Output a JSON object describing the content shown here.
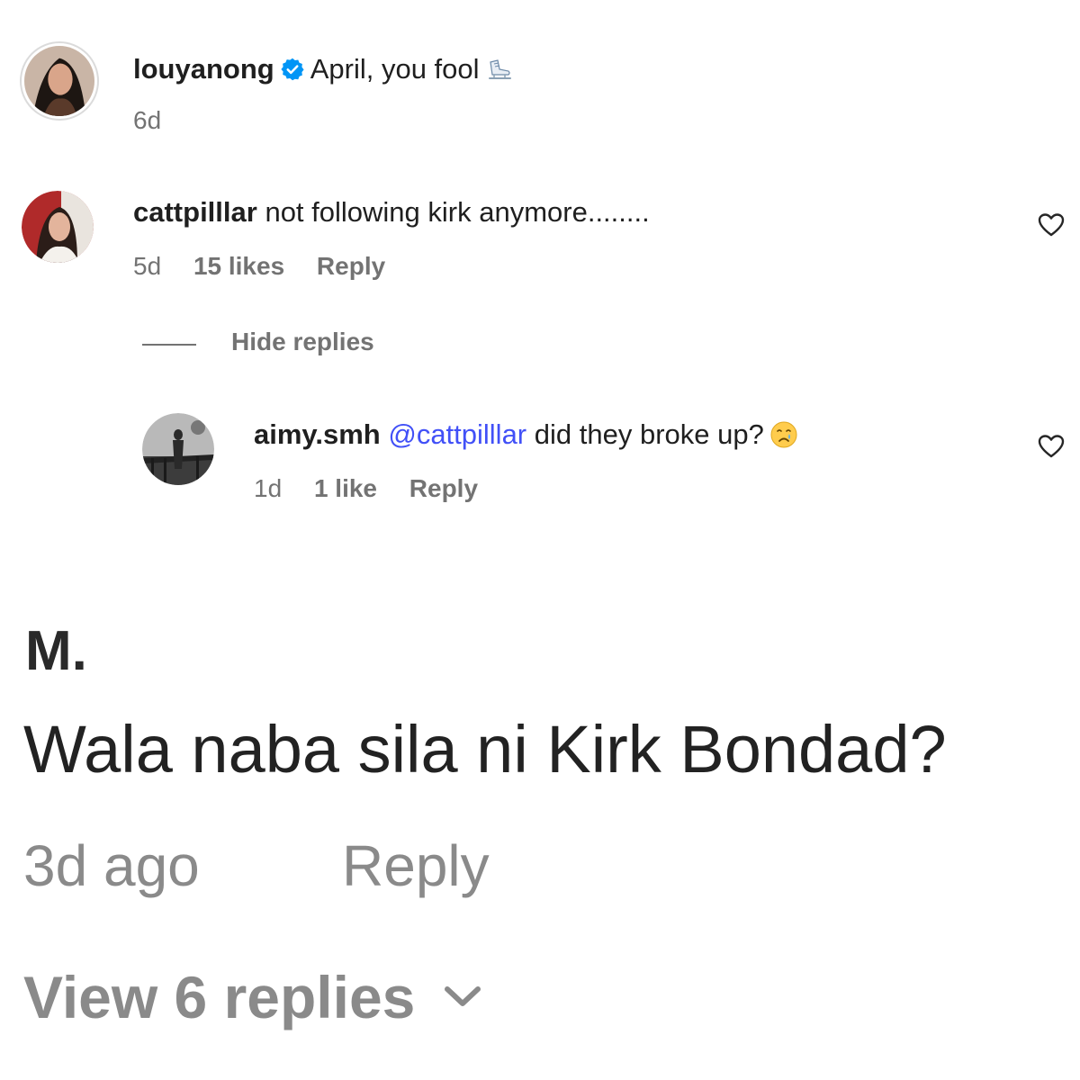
{
  "comments": [
    {
      "username": "louyanong",
      "text": "April, you fool",
      "time": "6d",
      "verified_icon": "verified-badge-icon",
      "emoji_icon": "ice-skate-emoji"
    },
    {
      "username": "cattpilllar",
      "text": "not following kirk anymore........",
      "time": "5d",
      "likes": "15 likes",
      "reply_label": "Reply",
      "like_icon": "heart-outline-icon"
    }
  ],
  "replies_toggle": "Hide replies",
  "reply": {
    "username": "aimy.smh",
    "mention": "@cattpilllar",
    "text": "did they broke up?",
    "time": "1d",
    "likes": "1 like",
    "reply_label": "Reply",
    "emoji_icon": "crying-face-emoji",
    "like_icon": "heart-outline-icon"
  },
  "second_comment": {
    "author": "M.",
    "text": "Wala naba sila ni Kirk Bondad?",
    "time": "3d ago",
    "reply_label": "Reply",
    "view_replies": "View 6 replies",
    "chevron_icon": "chevron-down-icon"
  },
  "colors": {
    "text": "#1f1f1f",
    "secondary": "#737373",
    "mention": "#4150f7",
    "verified": "#0095f6",
    "big_secondary": "#8a8a8a"
  }
}
